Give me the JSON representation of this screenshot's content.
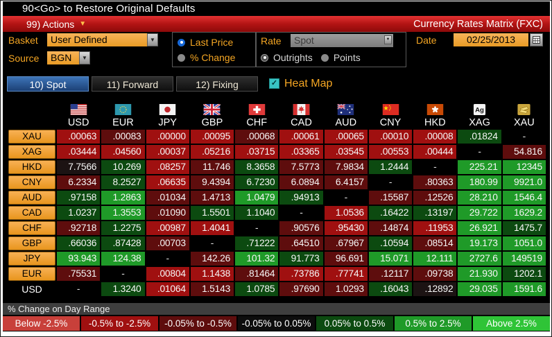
{
  "title_bar": "90<Go> to Restore Original Defaults",
  "toolbar": {
    "actions_label": "99) Actions",
    "app_title": "Currency Rates Matrix (FXC)"
  },
  "controls": {
    "basket_label": "Basket",
    "basket_value": "User Defined",
    "source_label": "Source",
    "source_value": "BGN",
    "last_price_label": "Last Price",
    "pct_change_label": "% Change",
    "price_mode_selected": "Last Price",
    "rate_label": "Rate",
    "rate_value": "Spot",
    "outrights_label": "Outrights",
    "points_label": "Points",
    "rate_mode_selected": "Outrights",
    "date_label": "Date",
    "date_value": "02/25/2013"
  },
  "tabs": [
    {
      "label": "10) Spot",
      "selected": true
    },
    {
      "label": "11) Forward",
      "selected": false
    },
    {
      "label": "12) Fixing",
      "selected": false
    }
  ],
  "heat_map": {
    "label": "Heat Map",
    "checked": true
  },
  "heat_colors": {
    "r2": "#a01010",
    "r1": "#5e0d0d",
    "n0": "#000000",
    "nv": "#1c1313",
    "g1": "#0c4a10",
    "g2": "#1f9a28"
  },
  "matrix": {
    "columns": [
      {
        "code": "USD",
        "icon": "us-flag-icon"
      },
      {
        "code": "EUR",
        "icon": "eu-flag-icon"
      },
      {
        "code": "JPY",
        "icon": "japan-flag-icon"
      },
      {
        "code": "GBP",
        "icon": "uk-flag-icon"
      },
      {
        "code": "CHF",
        "icon": "switzerland-flag-icon"
      },
      {
        "code": "CAD",
        "icon": "canada-flag-icon"
      },
      {
        "code": "AUD",
        "icon": "australia-flag-icon"
      },
      {
        "code": "CNY",
        "icon": "china-flag-icon"
      },
      {
        "code": "HKD",
        "icon": "hongkong-flag-icon"
      },
      {
        "code": "XAG",
        "icon": "silver-ag-icon"
      },
      {
        "code": "XAU",
        "icon": "gold-bars-icon"
      }
    ],
    "rows": [
      {
        "label": "XAU",
        "cells": [
          {
            "v": ".00063",
            "c": "r2"
          },
          {
            "v": ".00083",
            "c": "r1"
          },
          {
            "v": ".00000",
            "c": "r2"
          },
          {
            "v": ".00095",
            "c": "r2"
          },
          {
            "v": ".00068",
            "c": "r1"
          },
          {
            "v": ".00061",
            "c": "r2"
          },
          {
            "v": ".00065",
            "c": "r2"
          },
          {
            "v": ".00010",
            "c": "r2"
          },
          {
            "v": ".00008",
            "c": "r2"
          },
          {
            "v": ".01824",
            "c": "g1"
          },
          {
            "v": "-",
            "c": "n0"
          }
        ]
      },
      {
        "label": "XAG",
        "cells": [
          {
            "v": ".03444",
            "c": "r2"
          },
          {
            "v": ".04560",
            "c": "r2"
          },
          {
            "v": ".00037",
            "c": "r2"
          },
          {
            "v": ".05216",
            "c": "r2"
          },
          {
            "v": ".03715",
            "c": "r2"
          },
          {
            "v": ".03365",
            "c": "r2"
          },
          {
            "v": ".03545",
            "c": "r2"
          },
          {
            "v": ".00553",
            "c": "r2"
          },
          {
            "v": ".00444",
            "c": "r2"
          },
          {
            "v": "-",
            "c": "n0"
          },
          {
            "v": "54.816",
            "c": "r1"
          }
        ]
      },
      {
        "label": "HKD",
        "cells": [
          {
            "v": "7.7566",
            "c": "nv"
          },
          {
            "v": "10.269",
            "c": "g1"
          },
          {
            "v": ".08257",
            "c": "r2"
          },
          {
            "v": "11.746",
            "c": "r1"
          },
          {
            "v": "8.3658",
            "c": "g1"
          },
          {
            "v": "7.5773",
            "c": "r1"
          },
          {
            "v": "7.9834",
            "c": "r1"
          },
          {
            "v": "1.2444",
            "c": "g1"
          },
          {
            "v": "-",
            "c": "n0"
          },
          {
            "v": "225.21",
            "c": "g2"
          },
          {
            "v": "12345",
            "c": "g2"
          }
        ]
      },
      {
        "label": "CNY",
        "cells": [
          {
            "v": "6.2334",
            "c": "r1"
          },
          {
            "v": "8.2527",
            "c": "g1"
          },
          {
            "v": ".06635",
            "c": "r2"
          },
          {
            "v": "9.4394",
            "c": "r1"
          },
          {
            "v": "6.7230",
            "c": "g1"
          },
          {
            "v": "6.0894",
            "c": "r1"
          },
          {
            "v": "6.4157",
            "c": "r1"
          },
          {
            "v": "-",
            "c": "n0"
          },
          {
            "v": ".80363",
            "c": "r1"
          },
          {
            "v": "180.99",
            "c": "g2"
          },
          {
            "v": "9921.0",
            "c": "g2"
          }
        ]
      },
      {
        "label": "AUD",
        "cells": [
          {
            "v": ".97158",
            "c": "g1"
          },
          {
            "v": "1.2863",
            "c": "g2"
          },
          {
            "v": ".01034",
            "c": "r1"
          },
          {
            "v": "1.4713",
            "c": "r1"
          },
          {
            "v": "1.0479",
            "c": "g2"
          },
          {
            "v": ".94913",
            "c": "g1"
          },
          {
            "v": "-",
            "c": "n0"
          },
          {
            "v": ".15587",
            "c": "r1"
          },
          {
            "v": ".12526",
            "c": "r1"
          },
          {
            "v": "28.210",
            "c": "g2"
          },
          {
            "v": "1546.4",
            "c": "g2"
          }
        ]
      },
      {
        "label": "CAD",
        "cells": [
          {
            "v": "1.0237",
            "c": "g1"
          },
          {
            "v": "1.3553",
            "c": "g2"
          },
          {
            "v": ".01090",
            "c": "r1"
          },
          {
            "v": "1.5501",
            "c": "g1"
          },
          {
            "v": "1.1040",
            "c": "g1"
          },
          {
            "v": "-",
            "c": "n0"
          },
          {
            "v": "1.0536",
            "c": "r2"
          },
          {
            "v": ".16422",
            "c": "g1"
          },
          {
            "v": ".13197",
            "c": "g1"
          },
          {
            "v": "29.722",
            "c": "g2"
          },
          {
            "v": "1629.2",
            "c": "g2"
          }
        ]
      },
      {
        "label": "CHF",
        "cells": [
          {
            "v": ".92718",
            "c": "r1"
          },
          {
            "v": "1.2275",
            "c": "g1"
          },
          {
            "v": ".00987",
            "c": "r2"
          },
          {
            "v": "1.4041",
            "c": "r2"
          },
          {
            "v": "-",
            "c": "n0"
          },
          {
            "v": ".90576",
            "c": "r1"
          },
          {
            "v": ".95430",
            "c": "r2"
          },
          {
            "v": ".14874",
            "c": "r1"
          },
          {
            "v": ".11953",
            "c": "r2"
          },
          {
            "v": "26.921",
            "c": "g2"
          },
          {
            "v": "1475.7",
            "c": "g1"
          }
        ]
      },
      {
        "label": "GBP",
        "cells": [
          {
            "v": ".66036",
            "c": "g1"
          },
          {
            "v": ".87428",
            "c": "g1"
          },
          {
            "v": ".00703",
            "c": "r1"
          },
          {
            "v": "-",
            "c": "n0"
          },
          {
            "v": ".71222",
            "c": "g1"
          },
          {
            "v": ".64510",
            "c": "r1"
          },
          {
            "v": ".67967",
            "c": "r1"
          },
          {
            "v": ".10594",
            "c": "g1"
          },
          {
            "v": ".08514",
            "c": "r1"
          },
          {
            "v": "19.173",
            "c": "g2"
          },
          {
            "v": "1051.0",
            "c": "g2"
          }
        ]
      },
      {
        "label": "JPY",
        "cells": [
          {
            "v": "93.943",
            "c": "g2"
          },
          {
            "v": "124.38",
            "c": "g2"
          },
          {
            "v": "-",
            "c": "n0"
          },
          {
            "v": "142.26",
            "c": "r1"
          },
          {
            "v": "101.32",
            "c": "g2"
          },
          {
            "v": "91.773",
            "c": "g1"
          },
          {
            "v": "96.691",
            "c": "r1"
          },
          {
            "v": "15.071",
            "c": "g2"
          },
          {
            "v": "12.111",
            "c": "g2"
          },
          {
            "v": "2727.6",
            "c": "g2"
          },
          {
            "v": "149519",
            "c": "g2"
          }
        ]
      },
      {
        "label": "EUR",
        "cells": [
          {
            "v": ".75531",
            "c": "r1"
          },
          {
            "v": "-",
            "c": "n0"
          },
          {
            "v": ".00804",
            "c": "r2"
          },
          {
            "v": "1.1438",
            "c": "r2"
          },
          {
            "v": ".81464",
            "c": "r1"
          },
          {
            "v": ".73786",
            "c": "r2"
          },
          {
            "v": ".77741",
            "c": "r2"
          },
          {
            "v": ".12117",
            "c": "r1"
          },
          {
            "v": ".09738",
            "c": "r1"
          },
          {
            "v": "21.930",
            "c": "g2"
          },
          {
            "v": "1202.1",
            "c": "g1"
          }
        ]
      },
      {
        "label": "USD",
        "plain": true,
        "cells": [
          {
            "v": "-",
            "c": "n0"
          },
          {
            "v": "1.3240",
            "c": "g1"
          },
          {
            "v": ".01064",
            "c": "r2"
          },
          {
            "v": "1.5143",
            "c": "r1"
          },
          {
            "v": "1.0785",
            "c": "g1"
          },
          {
            "v": ".97690",
            "c": "r1"
          },
          {
            "v": "1.0293",
            "c": "r1"
          },
          {
            "v": ".16043",
            "c": "g1"
          },
          {
            "v": ".12892",
            "c": "nv"
          },
          {
            "v": "29.035",
            "c": "g2"
          },
          {
            "v": "1591.6",
            "c": "g2"
          }
        ]
      }
    ]
  },
  "legend": {
    "title": "% Change on Day Range",
    "items": [
      {
        "label": "Below -2.5%",
        "color": "#c8403a"
      },
      {
        "label": "-0.5% to -2.5%",
        "color": "#a01010"
      },
      {
        "label": "-0.05% to -0.5%",
        "color": "#5e0d0d"
      },
      {
        "label": "-0.05% to 0.05%",
        "color": "#0d0d0d"
      },
      {
        "label": "0.05% to 0.5%",
        "color": "#0c4a10"
      },
      {
        "label": "0.5% to 2.5%",
        "color": "#1f9a28"
      },
      {
        "label": "Above 2.5%",
        "color": "#2fc437"
      }
    ]
  }
}
